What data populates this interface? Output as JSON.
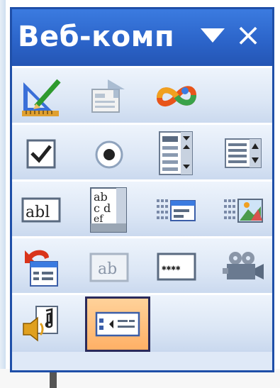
{
  "palette": {
    "title": "Веб-комп",
    "close_glyph": "×",
    "rows": [
      [
        "design-mode-icon",
        "properties-icon",
        "script-editor-icon"
      ],
      [
        "checkbox-icon",
        "radio-button-icon",
        "dropdown-list-icon",
        "list-box-icon"
      ],
      [
        "text-box-icon",
        "text-area-icon",
        "submit-button-icon",
        "image-submit-icon"
      ],
      [
        "reset-button-icon",
        "hidden-field-icon",
        "password-field-icon",
        "movie-icon"
      ],
      [
        "sound-icon",
        "scrolling-text-icon"
      ]
    ],
    "selected_tool": "scrolling-text-icon",
    "colors": {
      "titlebar": "#2b63c8",
      "border": "#1f4fa8",
      "body": "#dfe9f7",
      "selected": "#ffb066"
    }
  }
}
